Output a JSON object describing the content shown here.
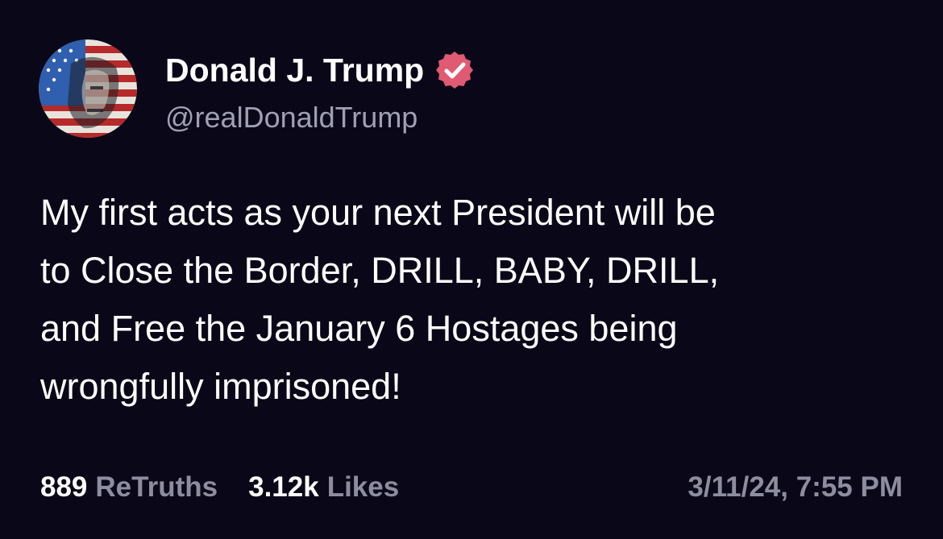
{
  "author": {
    "display_name": "Donald J. Trump",
    "handle": "@realDonaldTrump",
    "avatar_icon": "flag-portrait-avatar",
    "verified_icon": "verified-badge-icon"
  },
  "post": {
    "text": "My first acts as your next President will be\nto Close the Border, DRILL, BABY, DRILL,\nand Free the January 6 Hostages being\nwrongfully imprisoned!"
  },
  "stats": {
    "retruths_count": "889",
    "retruths_label": "ReTruths",
    "likes_count": "3.12k",
    "likes_label": "Likes"
  },
  "timestamp": "3/11/24, 7:55 PM",
  "colors": {
    "background": "#0a0818",
    "secondary_text": "#8e8d9f",
    "verified_badge": "#e05a72"
  }
}
